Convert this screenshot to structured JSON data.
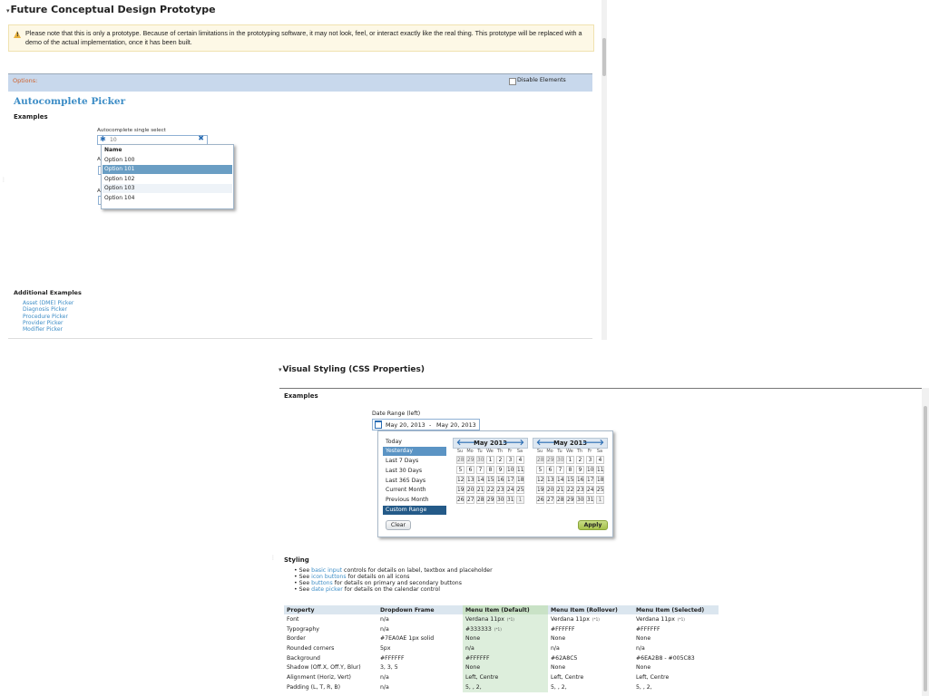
{
  "prototype": {
    "title": "Future Conceptual Design Prototype",
    "warning": "Please note that this is only a prototype. Because of certain limitations in the prototyping software, it may not look, feel, or interact exactly like the real thing. This prototype will be replaced with a demo of the actual implementation, once it has been built.",
    "options_label": "Options:",
    "disable_elements_label": "Disable Elements",
    "disable_elements_checked": false,
    "heading": "Autocomplete Picker",
    "examples_label": "Examples",
    "ac_label": "Autocomplete single select",
    "ac_value": "10",
    "hidden_label_1": "Au",
    "hidden_label_2": "Au",
    "dropdown": {
      "header": "Name",
      "options": [
        "Option 100",
        "Option 101",
        "Option 102",
        "Option 103",
        "Option 104"
      ],
      "selected_index": 1
    },
    "additional_examples_label": "Additional Examples",
    "additional_links": [
      "Asset (DME) Picker",
      "Diagnosis Picker",
      "Procedure Picker",
      "Provider Picker",
      "Modifier Picker"
    ]
  },
  "visual": {
    "title": "Visual Styling (CSS Properties)",
    "examples_label": "Examples",
    "date_range_label": "Date Range (left)",
    "date_start": "May 20, 2013",
    "date_sep": "-",
    "date_end": "May 20, 2013",
    "presets": [
      "Today",
      "Yesterday",
      "Last 7 Days",
      "Last 30 Days",
      "Last 365 Days",
      "Current Month",
      "Previous Month",
      "Custom Range"
    ],
    "selected_preset": 1,
    "calendars": [
      {
        "month_label": "May 2013"
      },
      {
        "month_label": "May 2013"
      }
    ],
    "dow": [
      "Su",
      "Mo",
      "Tu",
      "We",
      "Th",
      "Fr",
      "Sa"
    ],
    "weeks": [
      [
        "28",
        "29",
        "30",
        "1",
        "2",
        "3",
        "4"
      ],
      [
        "5",
        "6",
        "7",
        "8",
        "9",
        "10",
        "11"
      ],
      [
        "12",
        "13",
        "14",
        "15",
        "16",
        "17",
        "18"
      ],
      [
        "19",
        "20",
        "21",
        "22",
        "23",
        "24",
        "25"
      ],
      [
        "26",
        "27",
        "28",
        "29",
        "30",
        "31",
        "1"
      ]
    ],
    "clear_label": "Clear",
    "apply_label": "Apply",
    "styling_label": "Styling",
    "bullets": [
      {
        "pre": "See ",
        "link": "basic input",
        "post": " controls for details on label, textbox and placeholder"
      },
      {
        "pre": "See ",
        "link": "icon buttons",
        "post": " for details on all icons"
      },
      {
        "pre": "See ",
        "link": "buttons",
        "post": " for details on primary and secondary buttons"
      },
      {
        "pre": "See ",
        "link": "date picker",
        "post": " for details on the calendar control"
      }
    ],
    "table": {
      "headers": [
        "Property",
        "Dropdown Frame",
        "Menu Item (Default)",
        "Menu Item (Rollover)",
        "Menu Item (Selected)"
      ],
      "rows": [
        [
          "Font",
          "n/a",
          "Verdana 11px",
          "Verdana 11px",
          "Verdana 11px"
        ],
        [
          "Typography",
          "n/a",
          "#333333",
          "#FFFFFF",
          "#FFFFFF"
        ],
        [
          "Border",
          "#7EA0AE 1px solid",
          "None",
          "None",
          "None"
        ],
        [
          "Rounded corners",
          "5px",
          "n/a",
          "n/a",
          "n/a"
        ],
        [
          "Background",
          "#FFFFFF",
          "#FFFFFF",
          "#62A8C5",
          "#6EA2B8 - #005C83"
        ],
        [
          "Shadow (Off.X, Off.Y, Blur)",
          "3, 3, 5",
          "None",
          "None",
          "None"
        ],
        [
          "Alignment (Horiz, Vert)",
          "n/a",
          "Left, Centre",
          "Left, Centre",
          "Left, Centre"
        ],
        [
          "Padding (L, T, R, B)",
          "n/a",
          "5, , 2,",
          "5, , 2,",
          "5, , 2,"
        ]
      ],
      "note_marker": "(*1)"
    }
  }
}
